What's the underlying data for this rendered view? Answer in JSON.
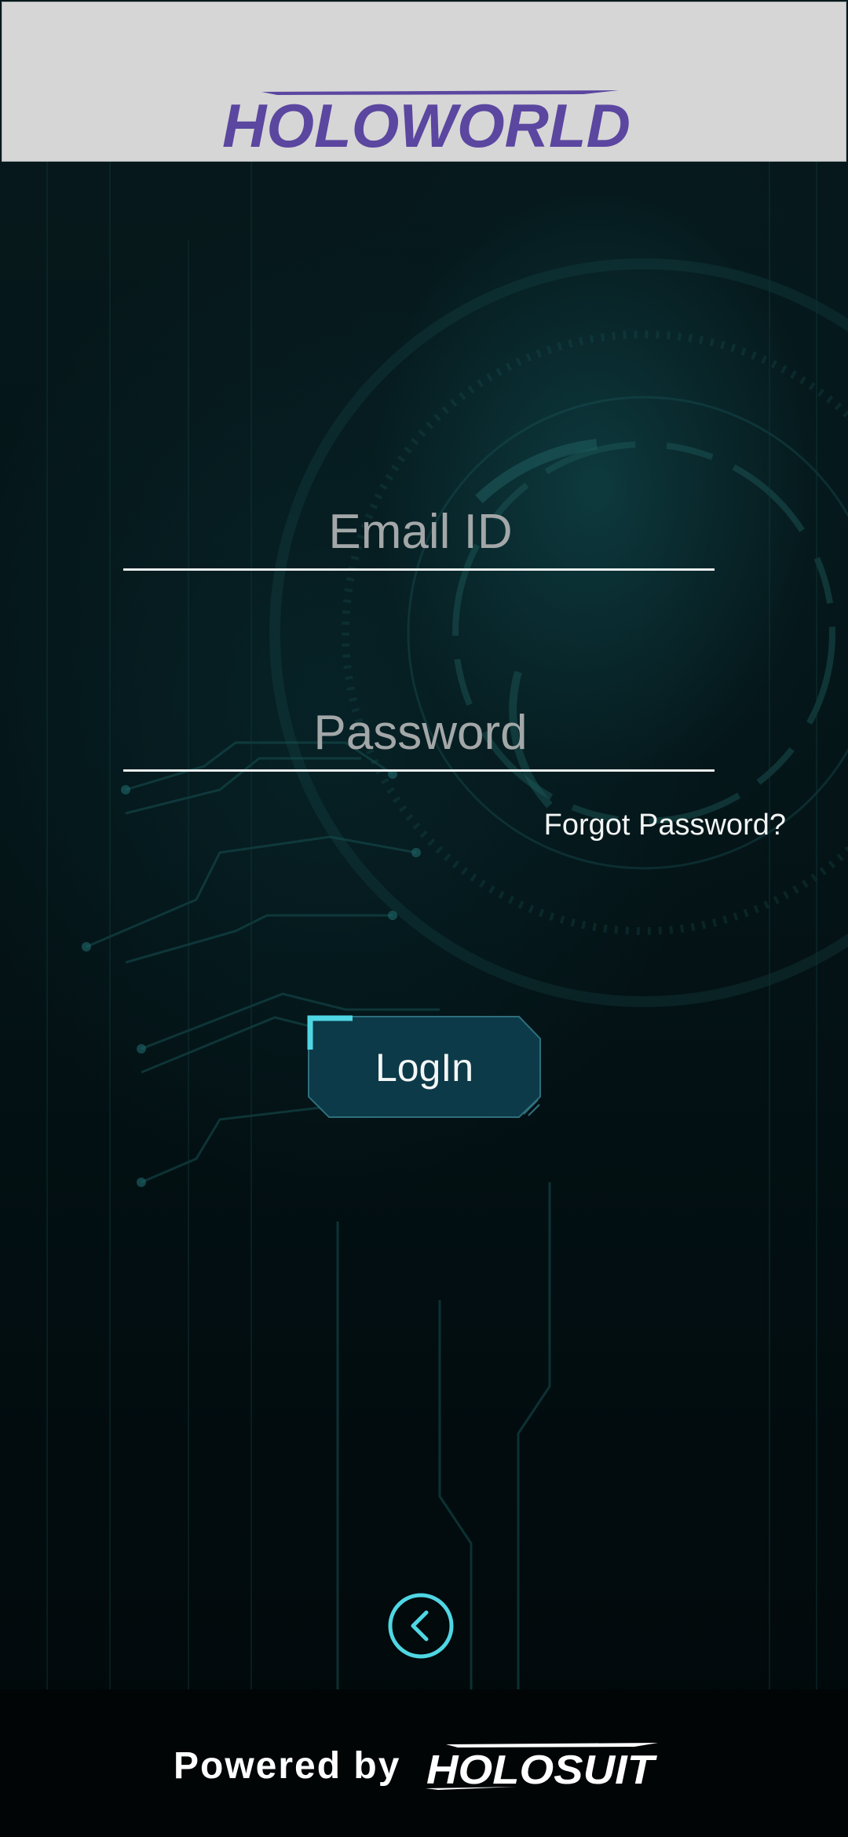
{
  "header": {
    "logo_text": "HOLOWORLD",
    "logo_color": "#5b46a0",
    "background": "#d6d6d6"
  },
  "login_form": {
    "email": {
      "placeholder": "Email ID",
      "value": ""
    },
    "password": {
      "placeholder": "Password",
      "value": ""
    },
    "forgot_password_label": "Forgot Password?",
    "login_button_label": "LogIn",
    "accent_color": "#4fd6e4",
    "button_fill": "#0c3a48"
  },
  "navigation": {
    "back_icon": "chevron-left-icon"
  },
  "footer": {
    "powered_by_label": "Powered by",
    "brand_logo_text": "HOLOSUIT"
  }
}
